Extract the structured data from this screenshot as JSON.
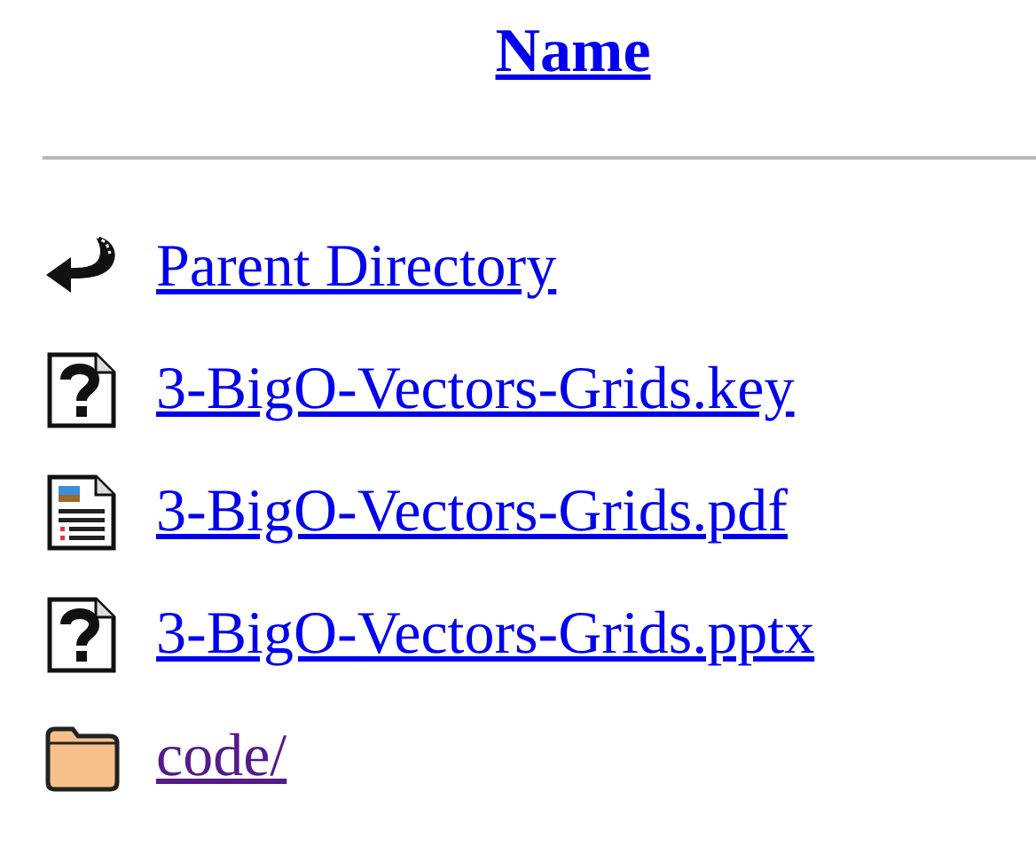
{
  "table": {
    "columns": [
      {
        "label": "Name"
      }
    ],
    "rows": [
      {
        "kind": "parent",
        "name": "Parent Directory",
        "visited": false
      },
      {
        "kind": "unknown",
        "name": "3-BigO-Vectors-Grids.key",
        "visited": false
      },
      {
        "kind": "document",
        "name": "3-BigO-Vectors-Grids.pdf",
        "visited": false
      },
      {
        "kind": "unknown",
        "name": "3-BigO-Vectors-Grids.pptx",
        "visited": false
      },
      {
        "kind": "folder",
        "name": "code/",
        "visited": true
      }
    ]
  }
}
